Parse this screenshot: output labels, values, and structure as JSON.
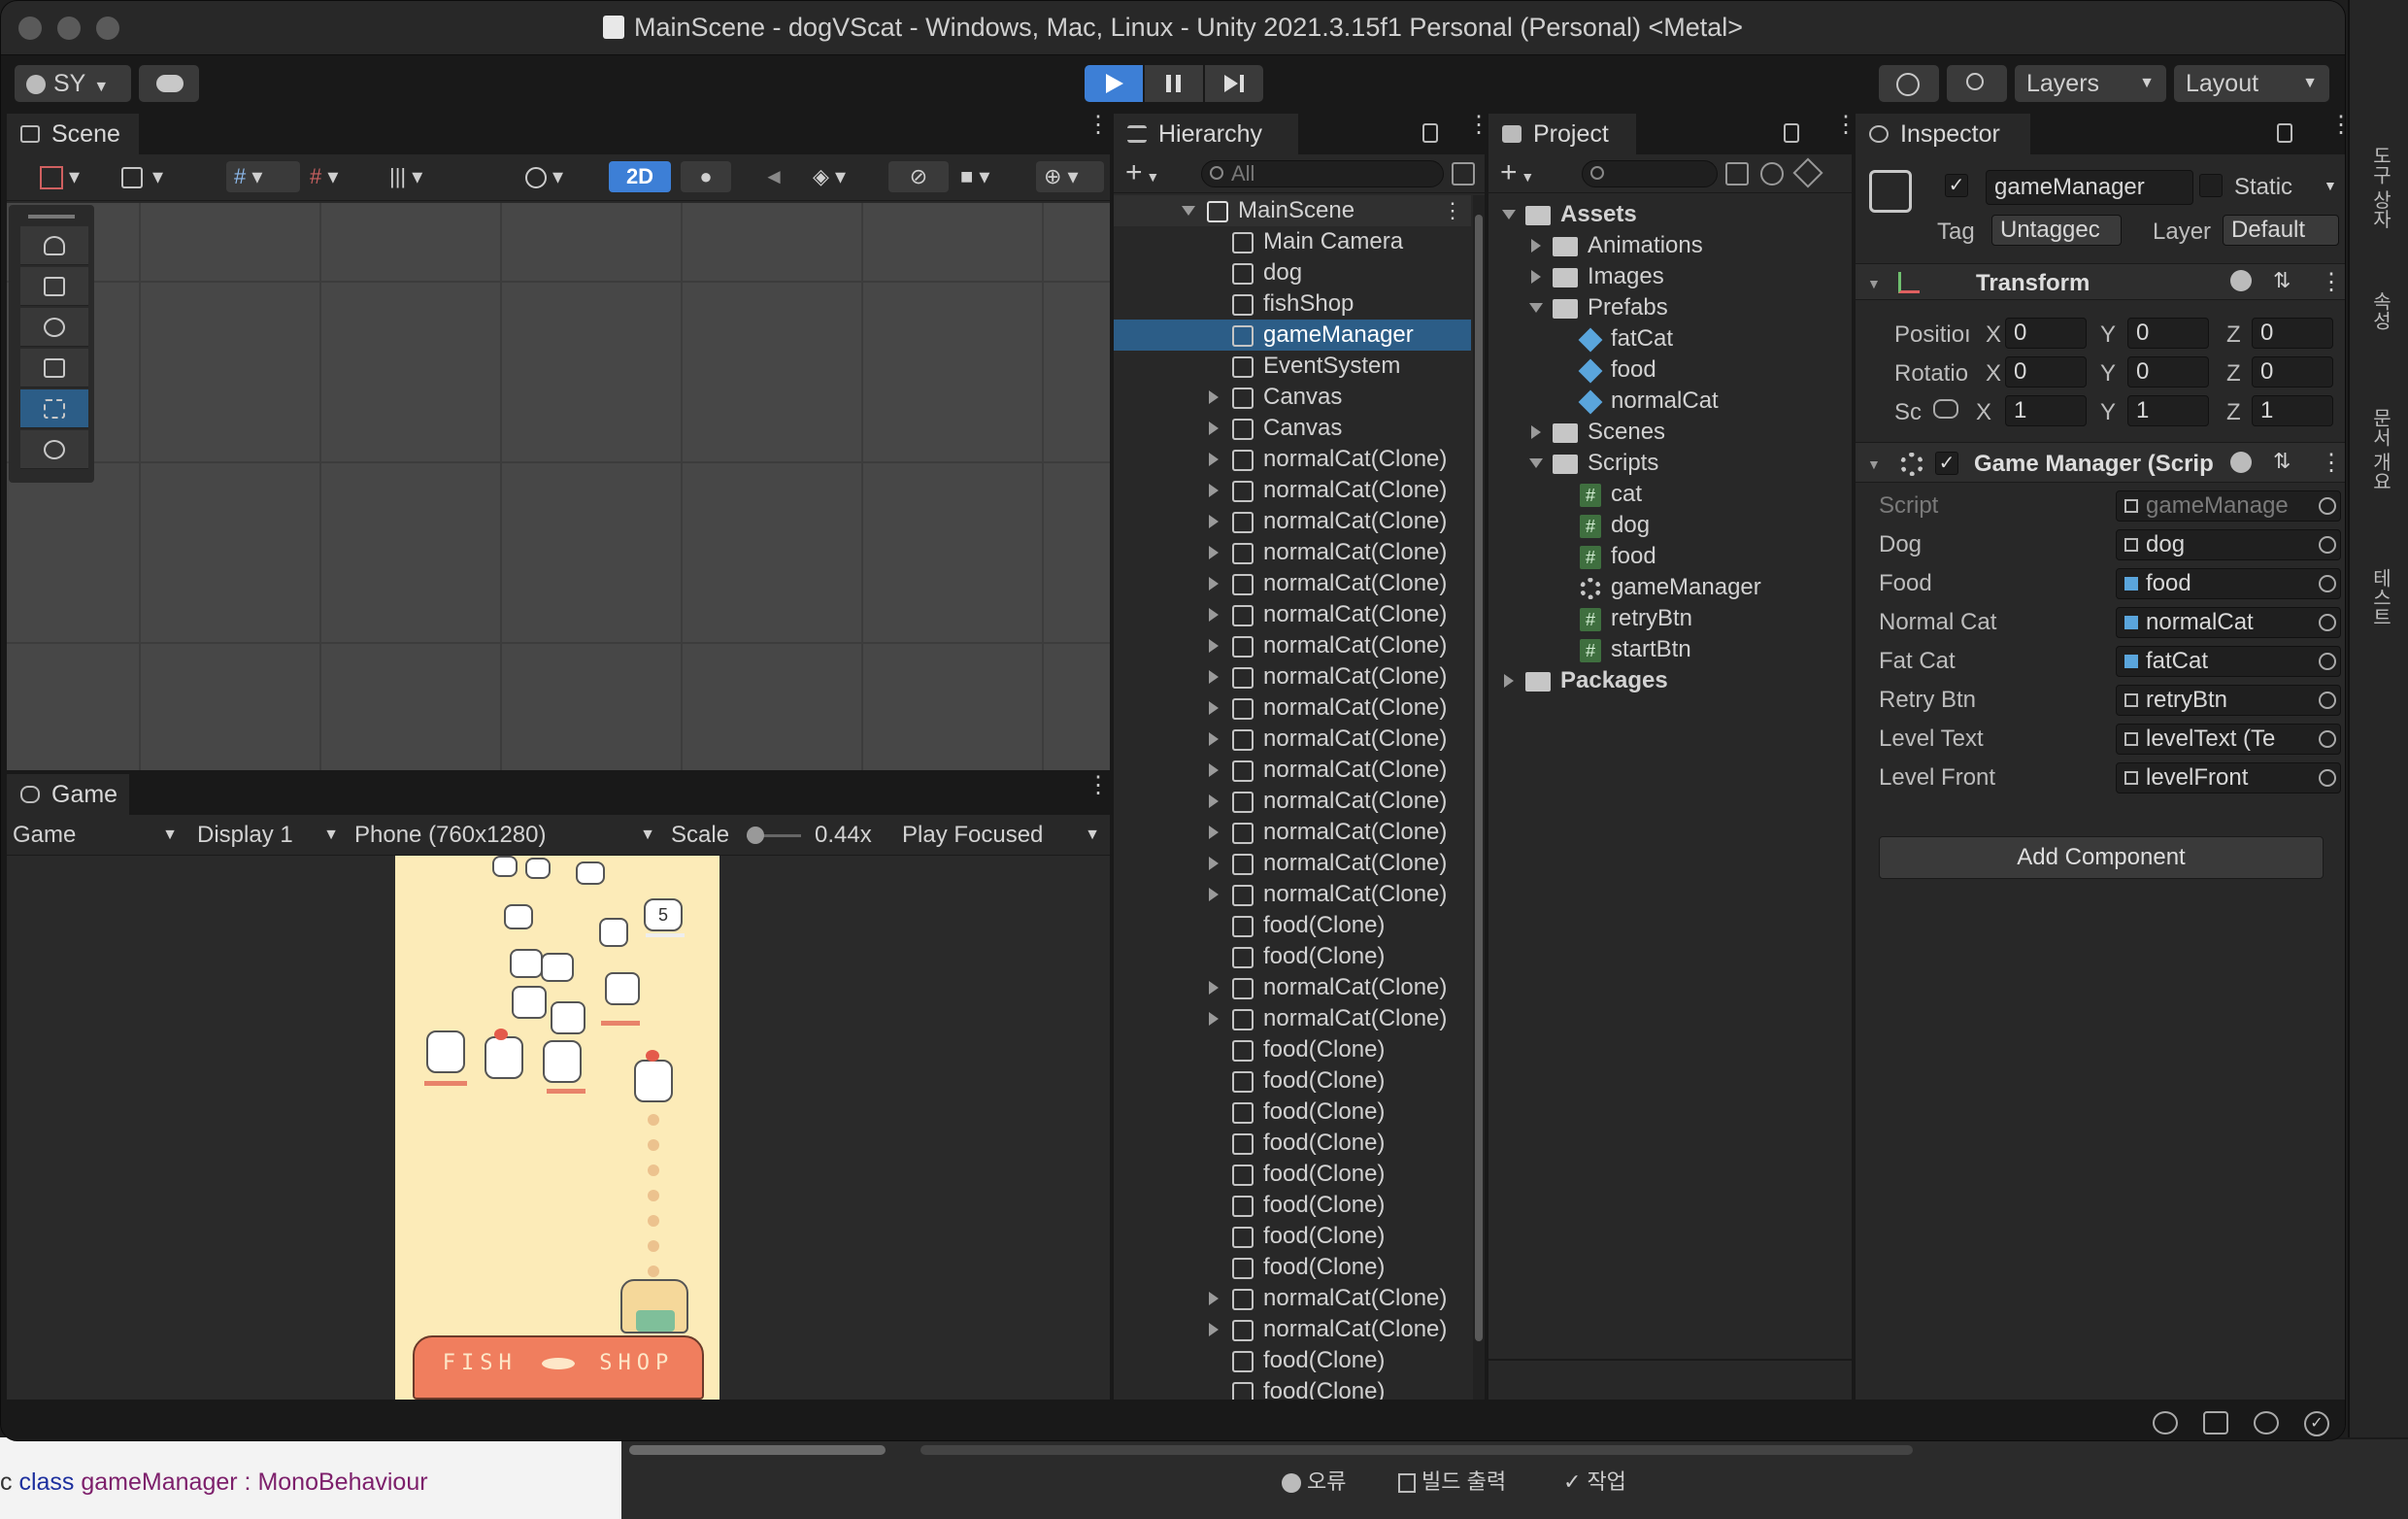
{
  "window": {
    "title": "MainScene - dogVScat - Windows, Mac, Linux - Unity 2021.3.15f1 Personal (Personal) <Metal>"
  },
  "toolbar": {
    "account": "SY",
    "layers": "Layers",
    "layout": "Layout"
  },
  "scene": {
    "tab": "Scene",
    "mode_2d": "2D"
  },
  "game": {
    "tab": "Game",
    "view_select": "Game",
    "display": "Display 1",
    "resolution": "Phone (760x1280)",
    "scale_label": "Scale",
    "scale_value": "0.44x",
    "play_mode": "Play Focused",
    "cat_level_badge": "5",
    "shop_sign_left": "FISH",
    "shop_sign_right": "SHOP"
  },
  "hierarchy": {
    "tab": "Hierarchy",
    "search_placeholder": "All",
    "root": "MainScene",
    "items": [
      {
        "label": "Main Camera",
        "expandable": false
      },
      {
        "label": "dog",
        "expandable": false
      },
      {
        "label": "fishShop",
        "expandable": false
      },
      {
        "label": "gameManager",
        "expandable": false,
        "selected": true
      },
      {
        "label": "EventSystem",
        "expandable": false
      },
      {
        "label": "Canvas",
        "expandable": true
      },
      {
        "label": "Canvas",
        "expandable": true
      },
      {
        "label": "normalCat(Clone)",
        "expandable": true
      },
      {
        "label": "normalCat(Clone)",
        "expandable": true
      },
      {
        "label": "normalCat(Clone)",
        "expandable": true
      },
      {
        "label": "normalCat(Clone)",
        "expandable": true
      },
      {
        "label": "normalCat(Clone)",
        "expandable": true
      },
      {
        "label": "normalCat(Clone)",
        "expandable": true
      },
      {
        "label": "normalCat(Clone)",
        "expandable": true
      },
      {
        "label": "normalCat(Clone)",
        "expandable": true
      },
      {
        "label": "normalCat(Clone)",
        "expandable": true
      },
      {
        "label": "normalCat(Clone)",
        "expandable": true
      },
      {
        "label": "normalCat(Clone)",
        "expandable": true
      },
      {
        "label": "normalCat(Clone)",
        "expandable": true
      },
      {
        "label": "normalCat(Clone)",
        "expandable": true
      },
      {
        "label": "normalCat(Clone)",
        "expandable": true
      },
      {
        "label": "normalCat(Clone)",
        "expandable": true
      },
      {
        "label": "food(Clone)",
        "expandable": false
      },
      {
        "label": "food(Clone)",
        "expandable": false
      },
      {
        "label": "normalCat(Clone)",
        "expandable": true
      },
      {
        "label": "normalCat(Clone)",
        "expandable": true
      },
      {
        "label": "food(Clone)",
        "expandable": false
      },
      {
        "label": "food(Clone)",
        "expandable": false
      },
      {
        "label": "food(Clone)",
        "expandable": false
      },
      {
        "label": "food(Clone)",
        "expandable": false
      },
      {
        "label": "food(Clone)",
        "expandable": false
      },
      {
        "label": "food(Clone)",
        "expandable": false
      },
      {
        "label": "food(Clone)",
        "expandable": false
      },
      {
        "label": "food(Clone)",
        "expandable": false
      },
      {
        "label": "normalCat(Clone)",
        "expandable": true
      },
      {
        "label": "normalCat(Clone)",
        "expandable": true
      },
      {
        "label": "food(Clone)",
        "expandable": false
      },
      {
        "label": "food(Clone)",
        "expandable": false
      }
    ]
  },
  "project": {
    "tab": "Project",
    "tree": [
      {
        "label": "Assets",
        "icon": "folder-open-icon",
        "level": 0,
        "arrow": "down",
        "bold": true
      },
      {
        "label": "Animations",
        "icon": "folder-icon",
        "level": 1,
        "arrow": "right"
      },
      {
        "label": "Images",
        "icon": "folder-icon",
        "level": 1,
        "arrow": "right"
      },
      {
        "label": "Prefabs",
        "icon": "folder-open-icon",
        "level": 1,
        "arrow": "down"
      },
      {
        "label": "fatCat",
        "icon": "prefab-icon",
        "level": 2,
        "arrow": ""
      },
      {
        "label": "food",
        "icon": "prefab-icon",
        "level": 2,
        "arrow": ""
      },
      {
        "label": "normalCat",
        "icon": "prefab-icon",
        "level": 2,
        "arrow": ""
      },
      {
        "label": "Scenes",
        "icon": "folder-icon",
        "level": 1,
        "arrow": "right"
      },
      {
        "label": "Scripts",
        "icon": "folder-open-icon",
        "level": 1,
        "arrow": "down"
      },
      {
        "label": "cat",
        "icon": "script-icon",
        "level": 2,
        "arrow": ""
      },
      {
        "label": "dog",
        "icon": "script-icon",
        "level": 2,
        "arrow": ""
      },
      {
        "label": "food",
        "icon": "script-icon",
        "level": 2,
        "arrow": ""
      },
      {
        "label": "gameManager",
        "icon": "gear-icon",
        "level": 2,
        "arrow": ""
      },
      {
        "label": "retryBtn",
        "icon": "script-icon",
        "level": 2,
        "arrow": ""
      },
      {
        "label": "startBtn",
        "icon": "script-icon",
        "level": 2,
        "arrow": ""
      },
      {
        "label": "Packages",
        "icon": "folder-icon",
        "level": 0,
        "arrow": "right",
        "bold": true
      }
    ]
  },
  "inspector": {
    "tab": "Inspector",
    "object_name": "gameManager",
    "static_label": "Static",
    "tag_label": "Tag",
    "tag_value": "Untaggec",
    "layer_label": "Layer",
    "layer_value": "Default",
    "transform": {
      "title": "Transform",
      "position_label": "Positioı",
      "rotation_label": "Rotatio",
      "scale_label": "Sc",
      "position": {
        "x": "0",
        "y": "0",
        "z": "0"
      },
      "rotation": {
        "x": "0",
        "y": "0",
        "z": "0"
      },
      "scale": {
        "x": "1",
        "y": "1",
        "z": "1"
      },
      "axis_x": "X",
      "axis_y": "Y",
      "axis_z": "Z"
    },
    "component": {
      "title": "Game Manager (Scrip",
      "fields": [
        {
          "label": "Script",
          "value": "gameManage",
          "icon": "script"
        },
        {
          "label": "Dog",
          "value": "dog",
          "icon": "object"
        },
        {
          "label": "Food",
          "value": "food",
          "icon": "prefab"
        },
        {
          "label": "Normal Cat",
          "value": "normalCat",
          "icon": "prefab"
        },
        {
          "label": "Fat Cat",
          "value": "fatCat",
          "icon": "prefab"
        },
        {
          "label": "Retry Btn",
          "value": "retryBtn",
          "icon": "object"
        },
        {
          "label": "Level Text",
          "value": "levelText (Te",
          "icon": "text"
        },
        {
          "label": "Level Front",
          "value": "levelFront",
          "icon": "object"
        }
      ]
    },
    "add_component": "Add Component"
  },
  "code_editor": {
    "prefix": "c",
    "keyword": "class",
    "class_name": "gameManager",
    "separator": ":",
    "base_class": "MonoBehaviour"
  },
  "status_bar": {
    "errors": "오류",
    "build_output": "빌드 출력",
    "tasks": "작업"
  },
  "vs_sidebar": {
    "items": [
      "도구 상자",
      "속성",
      "문서 개요",
      "테스트"
    ]
  },
  "colors": {
    "selection": "#2c5d87",
    "play_active": "#3d7fd6",
    "game_bg": "#fcebb8",
    "shop_roof": "#f07e5e"
  }
}
